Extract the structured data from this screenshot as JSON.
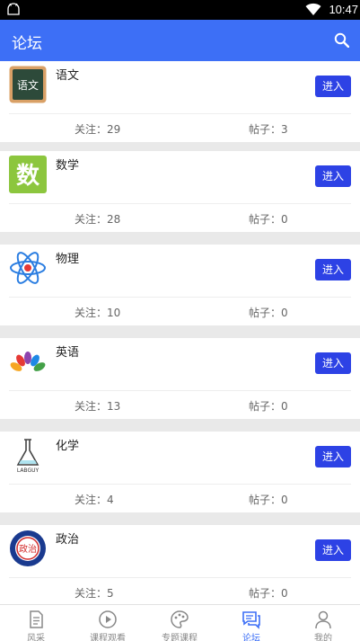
{
  "status_bar": {
    "time": "10:47",
    "icons": [
      "android-icon",
      "wifi-icon",
      "battery-icon"
    ]
  },
  "app_bar": {
    "title": "论坛",
    "search_icon": "search-icon"
  },
  "forums": [
    {
      "name": "语文",
      "enter_label": "进入",
      "follow_label": "关注：29",
      "posts_label": "帖子：3",
      "logo": "chinese-icon",
      "logo_text": "语文"
    },
    {
      "name": "数学",
      "enter_label": "进入",
      "follow_label": "关注：28",
      "posts_label": "帖子：0",
      "logo": "math-icon",
      "logo_text": "数"
    },
    {
      "name": "物理",
      "enter_label": "进入",
      "follow_label": "关注：10",
      "posts_label": "帖子：0",
      "logo": "physics-atom-icon"
    },
    {
      "name": "英语",
      "enter_label": "进入",
      "follow_label": "关注：13",
      "posts_label": "帖子：0",
      "logo": "english-peacock-icon"
    },
    {
      "name": "化学",
      "enter_label": "进入",
      "follow_label": "关注：4",
      "posts_label": "帖子：0",
      "logo": "chemistry-flask-icon",
      "logo_text": "LABGUY"
    },
    {
      "name": "政治",
      "enter_label": "进入",
      "follow_label": "关注：5",
      "posts_label": "帖子：0",
      "logo": "politics-seal-icon",
      "logo_text": "政治"
    }
  ],
  "bottom_nav": [
    {
      "label": "风采",
      "icon": "document-icon",
      "active": false
    },
    {
      "label": "课程观看",
      "icon": "play-icon",
      "active": false
    },
    {
      "label": "专题课程",
      "icon": "palette-icon",
      "active": false
    },
    {
      "label": "论坛",
      "icon": "chat-icon",
      "active": true
    },
    {
      "label": "我的",
      "icon": "person-icon",
      "active": false
    }
  ],
  "colors": {
    "primary": "#3d6ff6",
    "button": "#2d42e5",
    "background": "#e9e9e9"
  }
}
